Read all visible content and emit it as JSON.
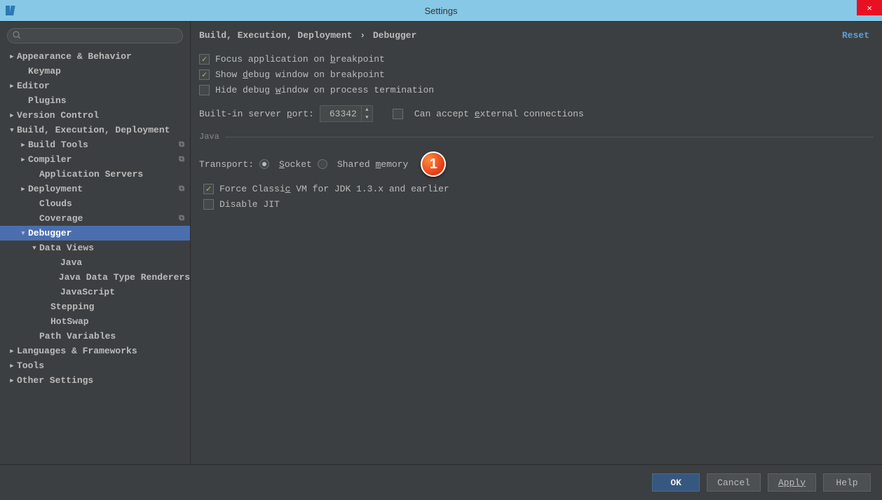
{
  "window": {
    "title": "Settings",
    "close": "×"
  },
  "search": {
    "placeholder": ""
  },
  "sidebar": {
    "items": [
      {
        "label": "Appearance & Behavior",
        "chev": "▶",
        "indent": 0
      },
      {
        "label": "Keymap",
        "chev": "",
        "indent": 1
      },
      {
        "label": "Editor",
        "chev": "▶",
        "indent": 0
      },
      {
        "label": "Plugins",
        "chev": "",
        "indent": 1
      },
      {
        "label": "Version Control",
        "chev": "▶",
        "indent": 0
      },
      {
        "label": "Build, Execution, Deployment",
        "chev": "▼",
        "indent": 0
      },
      {
        "label": "Build Tools",
        "chev": "▶",
        "indent": 1,
        "copy": true
      },
      {
        "label": "Compiler",
        "chev": "▶",
        "indent": 1,
        "copy": true
      },
      {
        "label": "Application Servers",
        "chev": "",
        "indent": 2
      },
      {
        "label": "Deployment",
        "chev": "▶",
        "indent": 1,
        "copy": true
      },
      {
        "label": "Clouds",
        "chev": "",
        "indent": 2
      },
      {
        "label": "Coverage",
        "chev": "",
        "indent": 2,
        "copy": true
      },
      {
        "label": "Debugger",
        "chev": "▼",
        "indent": 1,
        "selected": true
      },
      {
        "label": "Data Views",
        "chev": "▼",
        "indent": 2
      },
      {
        "label": "Java",
        "chev": "",
        "indent": 4
      },
      {
        "label": "Java Data Type Renderers",
        "chev": "",
        "indent": 4
      },
      {
        "label": "JavaScript",
        "chev": "",
        "indent": 4
      },
      {
        "label": "Stepping",
        "chev": "",
        "indent": 3
      },
      {
        "label": "HotSwap",
        "chev": "",
        "indent": 3
      },
      {
        "label": "Path Variables",
        "chev": "",
        "indent": 2
      },
      {
        "label": "Languages & Frameworks",
        "chev": "▶",
        "indent": 0
      },
      {
        "label": "Tools",
        "chev": "▶",
        "indent": 0
      },
      {
        "label": "Other Settings",
        "chev": "▶",
        "indent": 0
      }
    ]
  },
  "breadcrumb": {
    "part1": "Build, Execution, Deployment",
    "sep": "›",
    "part2": "Debugger",
    "reset": "Reset"
  },
  "settings": {
    "focus_on_breakpoint": {
      "label_pre": "Focus application on ",
      "und": "b",
      "label_post": "reakpoint",
      "checked": true
    },
    "show_debug_window": {
      "label_pre": "Show ",
      "und": "d",
      "label_mid": "ebug window on breakpoint",
      "checked": true
    },
    "hide_debug_window": {
      "label_pre": "Hide debug ",
      "und": "w",
      "label_post": "indow on process termination",
      "checked": false
    },
    "server_port": {
      "label_pre": "Built-in server ",
      "und": "p",
      "label_post": "ort:",
      "value": "63342"
    },
    "can_accept_ext": {
      "label_pre": "Can accept ",
      "und": "e",
      "label_post": "xternal connections",
      "checked": false
    },
    "java_section": "Java",
    "transport": {
      "label": "Transport:",
      "socket": {
        "und": "S",
        "rest": "ocket",
        "checked": true
      },
      "shared": {
        "pre": "Shared ",
        "und": "m",
        "rest": "emory",
        "checked": false
      }
    },
    "force_classic": {
      "label_pre": "Force Classi",
      "und": "c",
      "label_post": " VM for JDK 1.3.x and earlier",
      "checked": true
    },
    "disable_jit": {
      "label": "Disable JIT",
      "checked": false
    }
  },
  "callout": "1",
  "footer": {
    "ok": "OK",
    "cancel": "Cancel",
    "apply": "Apply",
    "help": "Help"
  }
}
